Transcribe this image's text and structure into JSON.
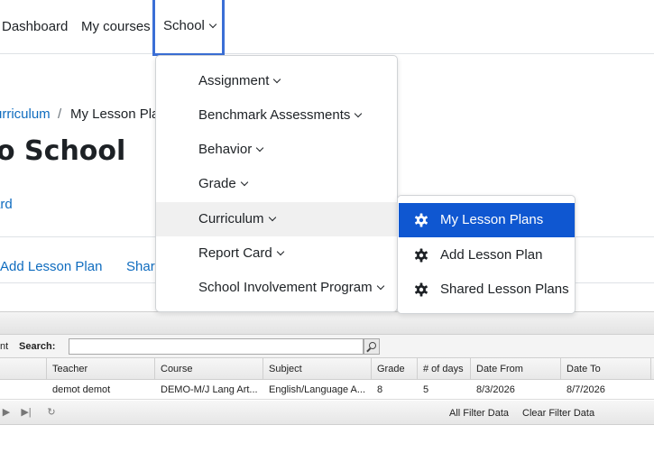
{
  "nav": {
    "dashboard": "Dashboard",
    "my_courses": "My courses",
    "school": "School"
  },
  "breadcrumb": {
    "link": "urriculum",
    "separator": "/",
    "current": "My Lesson Pla"
  },
  "page": {
    "title": "o School",
    "board_link": "ard"
  },
  "actions": {
    "add": "Add Lesson Plan",
    "share": "Share"
  },
  "grid": {
    "search_left_label": "nt",
    "search_label": "Search:",
    "search_value": "",
    "columns": [
      "Teacher",
      "Course",
      "Subject",
      "Grade",
      "# of days",
      "Date From",
      "Date To"
    ],
    "rows": [
      [
        "demot demot",
        "DEMO-M/J Lang Art...",
        "English/Language A...",
        "8",
        "5",
        "8/3/2026",
        "8/7/2026"
      ]
    ],
    "footer": {
      "all_filter": "All Filter Data",
      "clear_filter": "Clear Filter Data"
    }
  },
  "dropdown": {
    "items": [
      {
        "label": "Assignment"
      },
      {
        "label": "Benchmark Assessments"
      },
      {
        "label": "Behavior"
      },
      {
        "label": "Grade"
      },
      {
        "label": "Curriculum"
      },
      {
        "label": "Report Card"
      },
      {
        "label": "School Involvement Program"
      }
    ],
    "active_item": "Curriculum"
  },
  "submenu": {
    "items": [
      {
        "label": "My Lesson Plans",
        "icon": "gear-icon"
      },
      {
        "label": "Add Lesson Plan",
        "icon": "gear-icon"
      },
      {
        "label": "Shared Lesson Plans",
        "icon": "gear-icon"
      }
    ],
    "selected_item": "My Lesson Plans"
  },
  "colors": {
    "accent": "#0f57d1",
    "link": "#0f6cbf",
    "focus_border": "#3b6fd6"
  }
}
